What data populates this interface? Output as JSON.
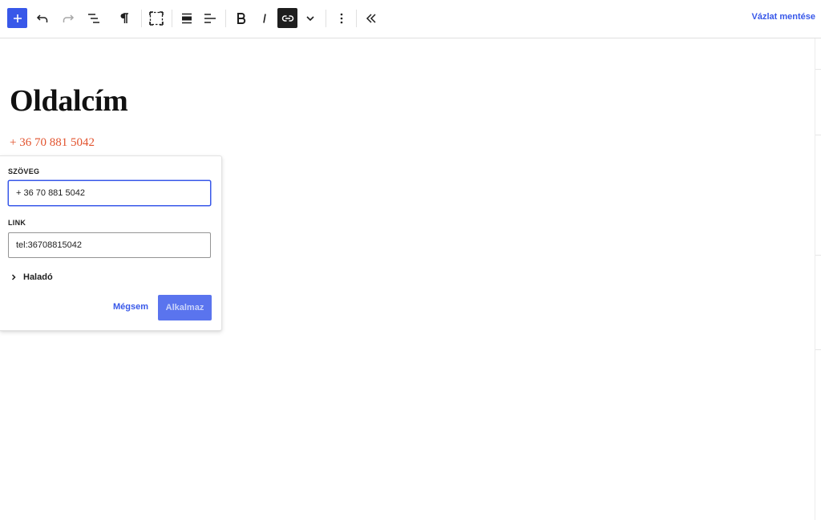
{
  "toolbar": {
    "save_draft_label": "Vázlat mentése",
    "accent_color": "#3858e9"
  },
  "toolbar_icons": [
    "plus-icon",
    "undo-icon",
    "redo-icon",
    "list-view-icon",
    "paragraph-icon",
    "block-select-icon",
    "align-icon",
    "align-left-icon",
    "bold-icon",
    "italic-icon",
    "link-icon",
    "chevron-down-icon",
    "more-options-icon",
    "collapse-toolbar-icon"
  ],
  "canvas": {
    "title": "Oldalcím",
    "link_text": "+ 36 70 881 5042",
    "link_color": "#e2532e"
  },
  "link_popover": {
    "text_label": "SZÖVEG",
    "text_value": "+ 36 70 881 5042",
    "link_label": "LINK",
    "link_value": "tel:36708815042",
    "advanced_label": "Haladó",
    "cancel_label": "Mégsem",
    "apply_label": "Alkalmaz"
  }
}
